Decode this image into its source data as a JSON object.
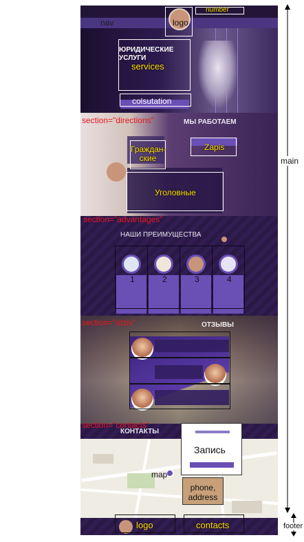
{
  "labels": {
    "number": "number",
    "nav": "nav",
    "logo_top": "logo",
    "services": "services",
    "consultation": "colsutation",
    "section_directions": "section=\"directions\"",
    "grazhdanskie": "Граждан-\nские",
    "ugolovnye": "Уголовные",
    "zapis_button": "Zapis",
    "section_advantages": "section=\"advantages\"",
    "adv_numbers": [
      "1",
      "2",
      "3",
      "4"
    ],
    "section_otziv": "section=\"otziv\"",
    "section_contacts": "section=\"contacts\"",
    "zapis_form": "Запись",
    "map": "map",
    "phone_address": "phone,\naddress",
    "logo_bottom": "logo",
    "contacts": "contacts",
    "main": "main",
    "footer": "footer"
  },
  "colors": {
    "annotation_red": "#e8161d",
    "annotation_yellow": "#ffe000",
    "site_purple": "#2b1a4a",
    "card_purple": "#6a4fb5",
    "phone_box": "#c7a07a"
  },
  "mock_text": {
    "hero_title": "ЮРИДИЧЕСКИЕ УСЛУГИ",
    "directions_title": "МЫ РАБОТАЕМ",
    "advantages_title": "НАШИ ПРЕИМУЩЕСТВА",
    "otziv_title": "ОТЗЫВЫ",
    "contacts_title": "КОНТАКТЫ"
  }
}
